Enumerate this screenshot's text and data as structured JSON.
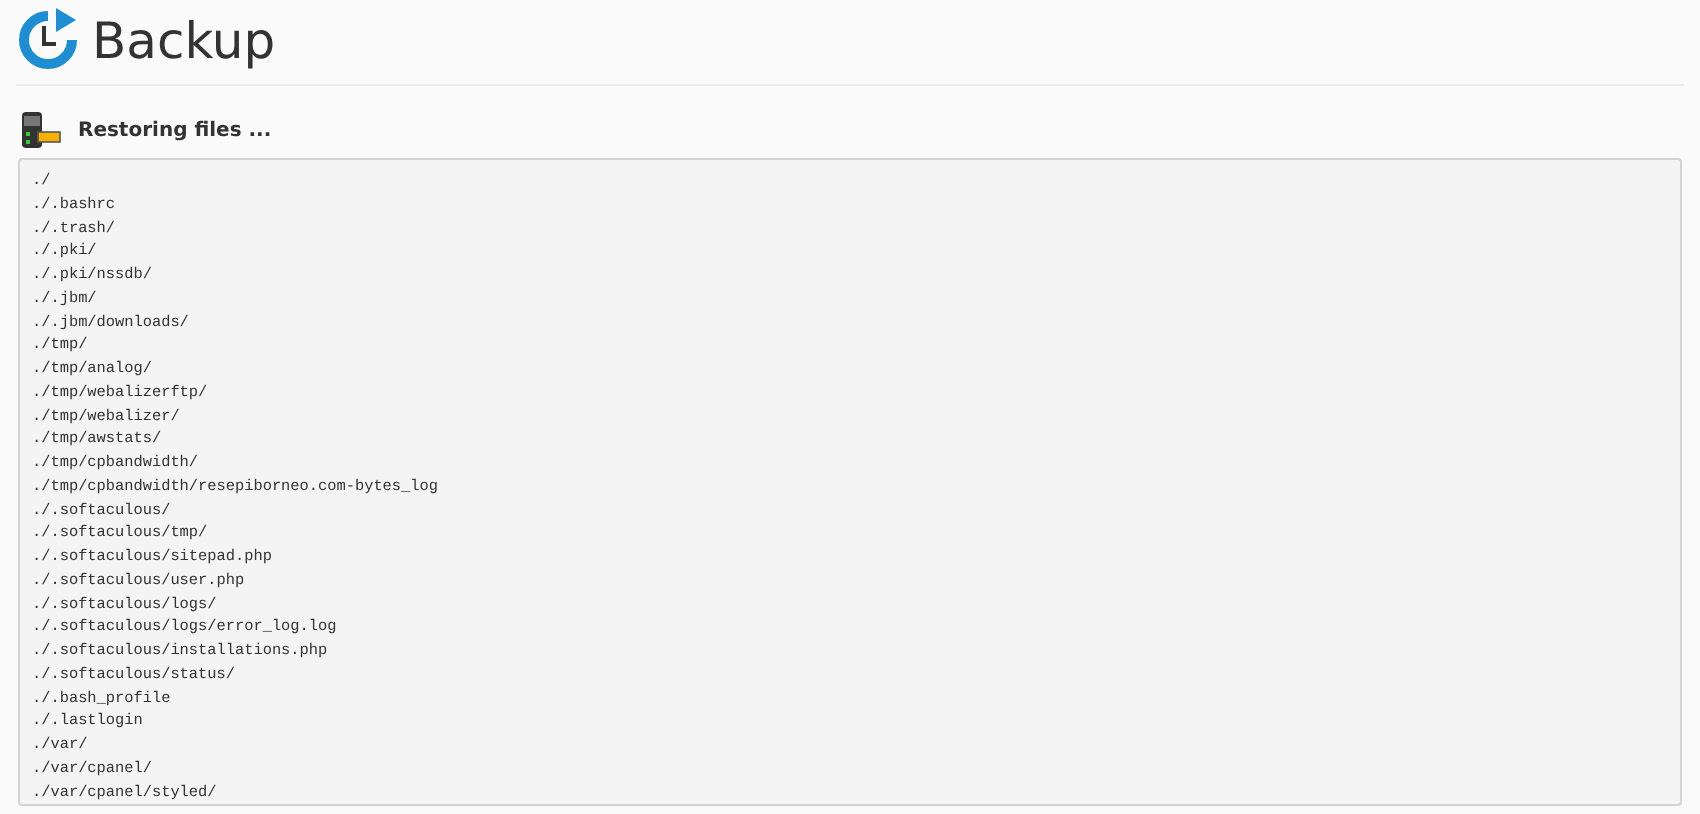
{
  "page": {
    "title": "Backup"
  },
  "status": {
    "text": "Restoring files ..."
  },
  "log_lines": [
    "./",
    "./.bashrc",
    "./.trash/",
    "./.pki/",
    "./.pki/nssdb/",
    "./.jbm/",
    "./.jbm/downloads/",
    "./tmp/",
    "./tmp/analog/",
    "./tmp/webalizerftp/",
    "./tmp/webalizer/",
    "./tmp/awstats/",
    "./tmp/cpbandwidth/",
    "./tmp/cpbandwidth/resepiborneo.com-bytes_log",
    "./.softaculous/",
    "./.softaculous/tmp/",
    "./.softaculous/sitepad.php",
    "./.softaculous/user.php",
    "./.softaculous/logs/",
    "./.softaculous/logs/error_log.log",
    "./.softaculous/installations.php",
    "./.softaculous/status/",
    "./.bash_profile",
    "./.lastlogin",
    "./var/",
    "./var/cpanel/",
    "./var/cpanel/styled/"
  ]
}
